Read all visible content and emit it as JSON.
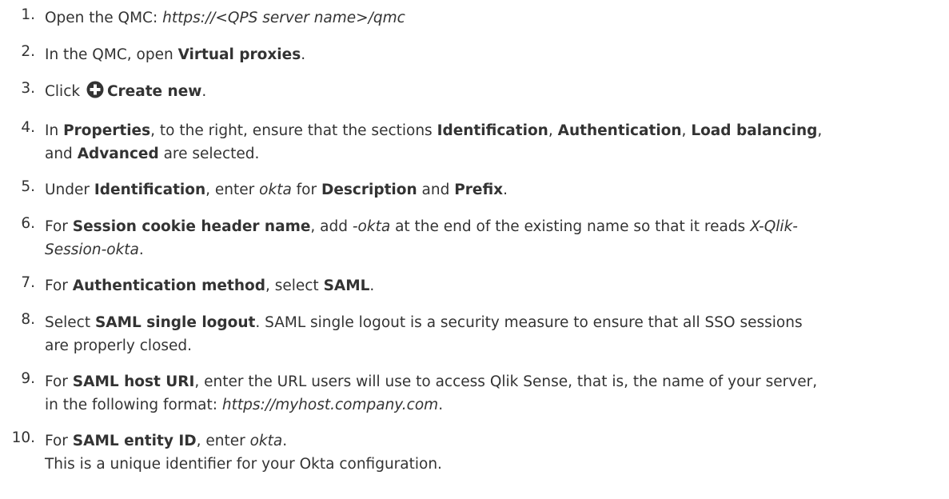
{
  "steps": [
    {
      "num": "1.",
      "lines": [
        [
          {
            "t": "Open the QMC: "
          },
          {
            "t": "https://<QPS server name>/qmc",
            "i": true
          }
        ]
      ]
    },
    {
      "num": "2.",
      "lines": [
        [
          {
            "t": "In the QMC, open "
          },
          {
            "t": "Virtual proxies",
            "b": true
          },
          {
            "t": "."
          }
        ]
      ]
    },
    {
      "num": "3.",
      "lines": [
        [
          {
            "t": "Click "
          },
          {
            "icon": "plus-circle-icon"
          },
          {
            "t": "Create new",
            "b": true
          },
          {
            "t": "."
          }
        ]
      ]
    },
    {
      "num": "4.",
      "lines": [
        [
          {
            "t": "In "
          },
          {
            "t": "Properties",
            "b": true
          },
          {
            "t": ", to the right, ensure that the sections "
          },
          {
            "t": "Identification",
            "b": true
          },
          {
            "t": ", "
          },
          {
            "t": "Authentication",
            "b": true
          },
          {
            "t": ", "
          },
          {
            "t": "Load balancing",
            "b": true
          },
          {
            "t": ","
          }
        ],
        [
          {
            "t": "and "
          },
          {
            "t": "Advanced",
            "b": true
          },
          {
            "t": " are selected."
          }
        ]
      ]
    },
    {
      "num": "5.",
      "lines": [
        [
          {
            "t": "Under "
          },
          {
            "t": "Identification",
            "b": true
          },
          {
            "t": ", enter "
          },
          {
            "t": "okta",
            "i": true
          },
          {
            "t": " for "
          },
          {
            "t": "Description",
            "b": true
          },
          {
            "t": " and "
          },
          {
            "t": "Prefix",
            "b": true
          },
          {
            "t": "."
          }
        ]
      ]
    },
    {
      "num": "6.",
      "lines": [
        [
          {
            "t": "For "
          },
          {
            "t": "Session cookie header name",
            "b": true
          },
          {
            "t": ", add "
          },
          {
            "t": "-okta",
            "i": true
          },
          {
            "t": " at the end of the existing name so that it reads "
          },
          {
            "t": "X-Qlik-",
            "i": true
          }
        ],
        [
          {
            "t": "Session-okta",
            "i": true
          },
          {
            "t": "."
          }
        ]
      ]
    },
    {
      "num": "7.",
      "lines": [
        [
          {
            "t": "For "
          },
          {
            "t": "Authentication method",
            "b": true
          },
          {
            "t": ", select "
          },
          {
            "t": "SAML",
            "b": true
          },
          {
            "t": "."
          }
        ]
      ]
    },
    {
      "num": "8.",
      "lines": [
        [
          {
            "t": "Select "
          },
          {
            "t": "SAML single logout",
            "b": true
          },
          {
            "t": ". SAML single logout is a security measure to ensure that all SSO sessions"
          }
        ],
        [
          {
            "t": "are properly closed."
          }
        ]
      ]
    },
    {
      "num": "9.",
      "lines": [
        [
          {
            "t": "For "
          },
          {
            "t": "SAML host URI",
            "b": true
          },
          {
            "t": ", enter the URL users will use to access Qlik Sense, that is, the name of your server,"
          }
        ],
        [
          {
            "t": "in the following format: "
          },
          {
            "t": "https://myhost.company.com",
            "i": true
          },
          {
            "t": "."
          }
        ]
      ]
    },
    {
      "num": "10.",
      "lines": [
        [
          {
            "t": "For "
          },
          {
            "t": "SAML entity ID",
            "b": true
          },
          {
            "t": ", enter "
          },
          {
            "t": "okta",
            "i": true
          },
          {
            "t": "."
          }
        ],
        [
          {
            "t": "This is a unique identifier for your Okta configuration."
          }
        ]
      ]
    }
  ]
}
